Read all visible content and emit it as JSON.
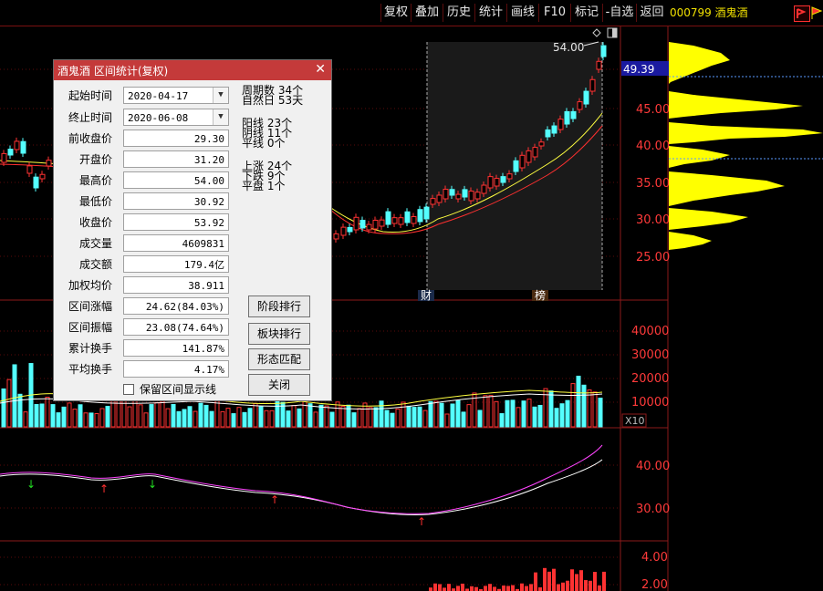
{
  "toolbar": {
    "buttons": [
      "复权",
      "叠加",
      "历史",
      "统计",
      "画线",
      "F10",
      "标记",
      "-自选",
      "返回"
    ],
    "stock_label": "000799 酒鬼酒"
  },
  "price_axis": {
    "current_price": "49.39",
    "ticks": [
      "45.00",
      "40.00",
      "35.00",
      "30.00",
      "25.00"
    ]
  },
  "volume_axis": {
    "ticks": [
      "40000",
      "30000",
      "20000",
      "10000"
    ],
    "multiplier": "X10"
  },
  "indicator_axis": {
    "ticks": [
      "40.00",
      "30.00"
    ]
  },
  "bottom_axis": {
    "ticks": [
      "4.00",
      "2.00"
    ]
  },
  "chart_labels": {
    "high_marker": "54.00",
    "event_cai": "财",
    "event_bang": "榜"
  },
  "colors": {
    "up": "#ff3232",
    "down": "#54ffff",
    "ma1": "#ffff40",
    "ma2": "#ff3030",
    "selection_bg": "#1a1a1a",
    "volume_profile": "#ffff00",
    "indicator_line_a": "#ffffff",
    "indicator_line_b": "#ff44ff"
  },
  "dialog": {
    "title": "酒鬼酒 区间统计(复权)",
    "fields": [
      {
        "label": "起始时间",
        "value": "2020-04-17"
      },
      {
        "label": "终止时间",
        "value": "2020-06-08"
      },
      {
        "label": "前收盘价",
        "value": "29.30"
      },
      {
        "label": "开盘价",
        "value": "31.20"
      },
      {
        "label": "最高价",
        "value": "54.00"
      },
      {
        "label": "最低价",
        "value": "30.92"
      },
      {
        "label": "收盘价",
        "value": "53.92"
      },
      {
        "label": "成交量",
        "value": "4609831"
      },
      {
        "label": "成交额",
        "value": "179.4亿"
      },
      {
        "label": "加权均价",
        "value": "38.911"
      },
      {
        "label": "区间涨幅",
        "value": "24.62(84.03%)"
      },
      {
        "label": "区间振幅",
        "value": "23.08(74.64%)"
      },
      {
        "label": "累计换手",
        "value": "141.87%"
      },
      {
        "label": "平均换手",
        "value": "4.17%"
      }
    ],
    "stats": [
      {
        "label": "周期数",
        "value": "34个"
      },
      {
        "label": "自然日",
        "value": "53天"
      },
      {
        "label": "阳线",
        "value": "23个"
      },
      {
        "label": "阴线",
        "value": "11个"
      },
      {
        "label": "平线",
        "value": "0个"
      },
      {
        "label": "上涨",
        "value": "24个"
      },
      {
        "label": "下跌",
        "value": "9个"
      },
      {
        "label": "平盘",
        "value": "1个"
      }
    ],
    "buttons": [
      "阶段排行",
      "板块排行",
      "形态匹配",
      "关闭"
    ],
    "keep_lines_label": "保留区间显示线",
    "keep_lines_checked": false
  }
}
